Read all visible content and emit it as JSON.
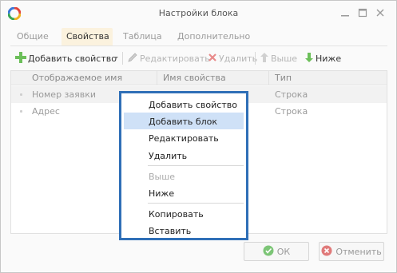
{
  "window": {
    "title": "Настройки блока",
    "app_icon": "colorful-ring-icon",
    "controls": [
      "minimize-icon",
      "maximize-icon",
      "close-icon"
    ]
  },
  "tabs": [
    {
      "label": "Общие",
      "active": false
    },
    {
      "label": "Свойства",
      "active": true
    },
    {
      "label": "Таблица",
      "active": false
    },
    {
      "label": "Дополнительно",
      "active": false
    }
  ],
  "toolbar": {
    "add": "Добавить свойство",
    "edit": "Редактировать",
    "delete": "Удалить",
    "up": "Выше",
    "down": "Ниже"
  },
  "grid": {
    "columns": [
      "Отображаемое имя",
      "Имя свойства",
      "Тип"
    ],
    "rows": [
      {
        "display_name": "Номер заявки",
        "property_name": "",
        "type": "Строка"
      },
      {
        "display_name": "Адрес",
        "property_name": "",
        "type": "Строка"
      }
    ]
  },
  "context_menu": {
    "items": [
      {
        "label": "Добавить свойство",
        "highlighted": false,
        "disabled": false
      },
      {
        "label": "Добавить блок",
        "highlighted": true,
        "disabled": false
      },
      {
        "label": "Редактировать",
        "highlighted": false,
        "disabled": false
      },
      {
        "label": "Удалить",
        "highlighted": false,
        "disabled": false
      },
      {
        "label": "Выше",
        "highlighted": false,
        "disabled": true
      },
      {
        "label": "Ниже",
        "highlighted": false,
        "disabled": false
      },
      {
        "label": "Копировать",
        "highlighted": false,
        "disabled": false
      },
      {
        "label": "Вставить",
        "highlighted": false,
        "disabled": false
      }
    ]
  },
  "footer": {
    "ok": "ОК",
    "cancel": "Отменить"
  },
  "colors": {
    "accent": "#2f6fb7",
    "highlight": "#cfe1f7",
    "tab_active": "#fbf2de",
    "ok_icon": "#7cc576",
    "cancel_icon": "#e07a7a",
    "add_icon": "#6cbf5a",
    "delete_icon": "#e06a6a"
  }
}
